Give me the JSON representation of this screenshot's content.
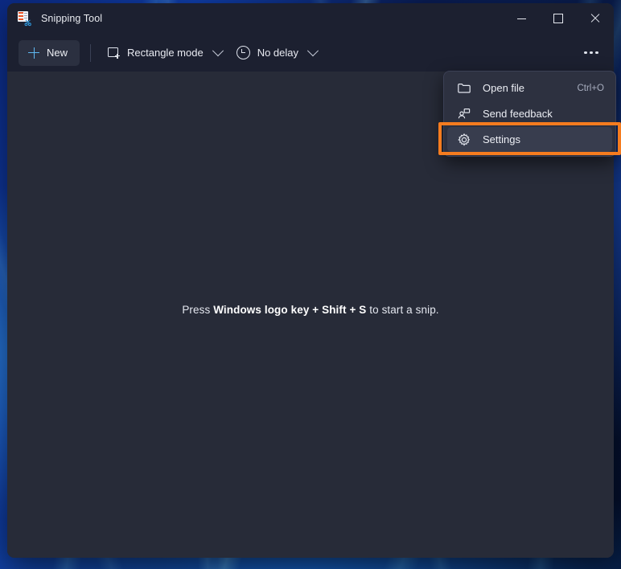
{
  "window": {
    "title": "Snipping Tool",
    "app_icon": "snipping-tool-icon",
    "controls": {
      "minimize": "Minimize",
      "maximize": "Maximize",
      "close": "Close"
    }
  },
  "toolbar": {
    "new_label": "New",
    "new_icon": "plus-icon",
    "mode": {
      "label": "Rectangle mode",
      "icon": "rectangle-snip-icon",
      "chevron": "chevron-down-icon"
    },
    "delay": {
      "label": "No delay",
      "icon": "clock-icon",
      "chevron": "chevron-down-icon"
    },
    "more_icon": "ellipsis-icon"
  },
  "content": {
    "hint_prefix": "Press ",
    "hint_keys": "Windows logo key + Shift + S",
    "hint_suffix": " to start a snip."
  },
  "menu": {
    "items": [
      {
        "label": "Open file",
        "icon": "folder-icon",
        "shortcut": "Ctrl+O",
        "active": false
      },
      {
        "label": "Send feedback",
        "icon": "send-feedback-icon",
        "shortcut": "",
        "active": false
      },
      {
        "label": "Settings",
        "icon": "gear-icon",
        "shortcut": "",
        "active": true
      }
    ]
  },
  "annotation": {
    "highlight_color": "#f57c1f",
    "target": "Settings"
  },
  "colors": {
    "titlebar": "#1c2030",
    "content": "#272b38",
    "menu": "#2d3140",
    "accent": "#5fb8f0"
  }
}
